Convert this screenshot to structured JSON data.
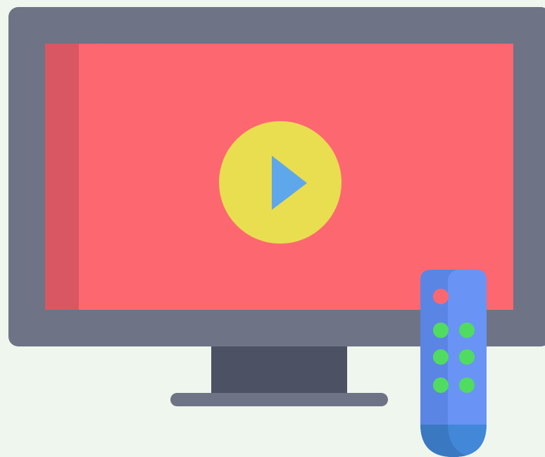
{
  "scene": {
    "subject": "tv-with-remote",
    "colors": {
      "background": "#eff6ed",
      "tv_frame": "#6e7385",
      "screen": "#fd6870",
      "screen_shadow": "#d95763",
      "play_circle": "#e9dd50",
      "play_triangle": "#5ea7ea",
      "stand_neck": "#4c5263",
      "stand_base": "#6e7385",
      "remote_body": "#6a93f6",
      "remote_shadow": "#5b85e4",
      "remote_bottom": "#4287d8",
      "remote_bottom_shadow": "#3b78c2",
      "power_button": "#fd6870",
      "keypad_button": "#50dc60"
    },
    "icons": {
      "television": "tv-icon",
      "play": "play-icon",
      "remote": "remote-control-icon"
    },
    "remote": {
      "keypad_rows": 3,
      "keypad_columns": 2
    }
  }
}
